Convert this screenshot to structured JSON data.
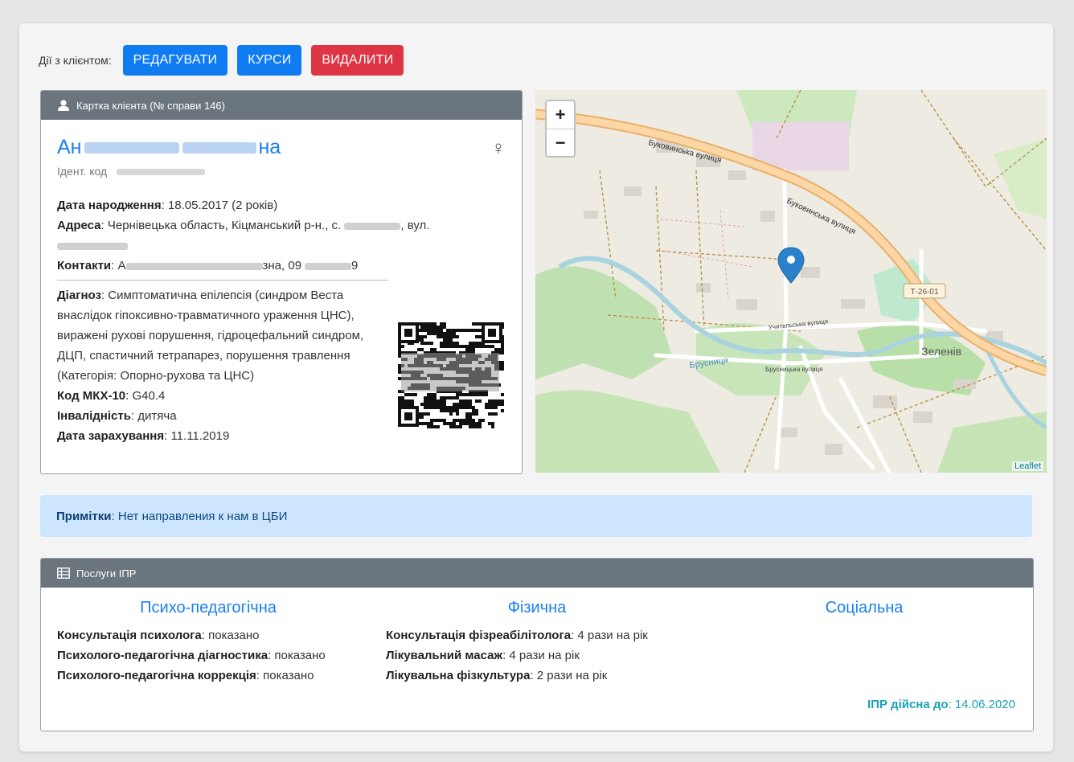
{
  "actions": {
    "label": "Дії з клієнтом:",
    "edit": "РЕДАГУВАТИ",
    "courses": "КУРСИ",
    "delete": "ВИДАЛИТИ"
  },
  "card": {
    "header": "Картка клієнта (№ справи 146)",
    "name_start": "Ан",
    "name_end": "на",
    "gender_symbol": "♀",
    "ident_label": "Ідент. код",
    "birth_label": "Дата народження",
    "birth_value": "18.05.2017 (2 років)",
    "address_label": "Адреса",
    "address_value": "Чернівецька область, Кіцманський р-н., с.",
    "address_tail": ", вул.",
    "contacts_label": "Контакти",
    "contacts_part1": "А",
    "contacts_part2": "зна, 09",
    "contacts_part3": "9",
    "diagnosis_label": "Діагноз",
    "diagnosis_value": "Симптоматична епілепсія (синдром Веста внаслідок гіпоксивно-травматичного ураження ЦНС), виражені рухові порушення, гідроцефальний синдром, ДЦП, спастичний тетрапарез, порушення травлення (Категорія: Опорно-рухова та ЦНС)",
    "mkh_label": "Код МКХ-10",
    "mkh_value": "G40.4",
    "disability_label": "Інвалідність",
    "disability_value": "дитяча",
    "enroll_label": "Дата зарахування",
    "enroll_value": "11.11.2019"
  },
  "map": {
    "zoom_in": "+",
    "zoom_out": "−",
    "attribution": "Leaflet",
    "labels": {
      "street1": "Буковинська вулиця",
      "street2": "Буковинська вулиця",
      "road": "Т-26-01",
      "village": "Зеленів",
      "river": "Брусниця",
      "street3": "Брусницька вулиця",
      "street4": "Учительська вулиця"
    }
  },
  "notes": {
    "label": "Примітки",
    "value": "Нет направления к нам в ЦБИ"
  },
  "services": {
    "header": "Послуги ІПР",
    "columns": [
      {
        "title": "Психо-педагогічна",
        "items": [
          {
            "label": "Консультація психолога",
            "value": "показано"
          },
          {
            "label": "Психолого-педагогічна діагностика",
            "value": "показано"
          },
          {
            "label": "Психолого-педагогічна коррекція",
            "value": "показано"
          }
        ]
      },
      {
        "title": "Фізична",
        "items": [
          {
            "label": "Консультація фізреабілітолога",
            "value": "4 рази на рік"
          },
          {
            "label": "Лікувальний масаж",
            "value": "4 рази на рік"
          },
          {
            "label": "Лікувальна фізкультура",
            "value": "2 рази на рік"
          }
        ]
      },
      {
        "title": "Соціальна",
        "items": []
      }
    ],
    "ipr_label": "ІПР дійсна до",
    "ipr_value": "14.06.2020"
  }
}
